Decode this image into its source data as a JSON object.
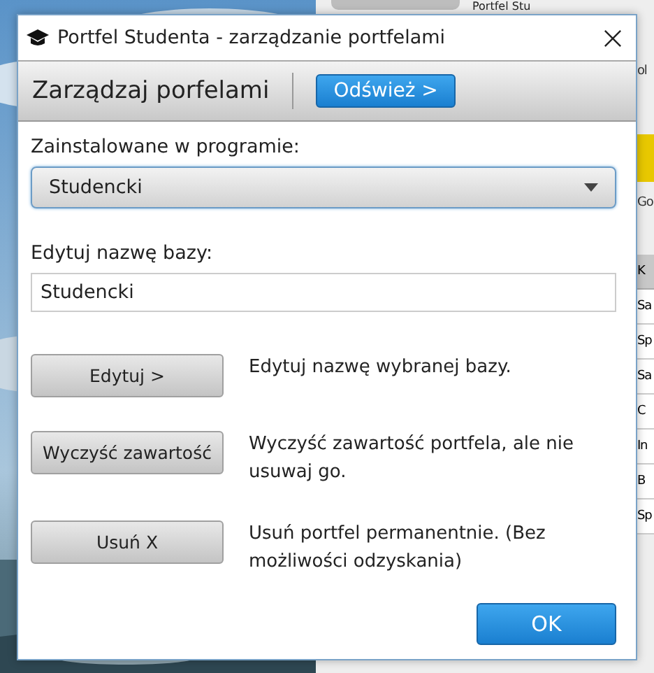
{
  "background_app": {
    "title": "Portfel Stu",
    "side_texts": [
      "ol",
      "Go"
    ],
    "table": {
      "header": "K",
      "rows": [
        "Sa",
        "Sp",
        "Sa",
        "C",
        "In",
        "B",
        "Sp"
      ]
    }
  },
  "dialog": {
    "title": "Portfel Studenta - zarządzanie portfelami",
    "toolbar": {
      "heading": "Zarządzaj porfelami",
      "refresh_button": "Odśwież >"
    },
    "installed": {
      "label": "Zainstalowane w programie:",
      "value": "Studencki"
    },
    "rename": {
      "label": "Edytuj nazwę bazy:",
      "value": "Studencki"
    },
    "actions": [
      {
        "button": "Edytuj >",
        "description": "Edytuj nazwę wybranej bazy."
      },
      {
        "button": "Wyczyść zawartość",
        "description": "Wyczyść zawartość portfela, ale nie usuwaj go."
      },
      {
        "button": "Usuń X",
        "description": "Usuń portfel permanentnie. (Bez możliwości odzyskania)"
      }
    ],
    "ok_button": "OK"
  }
}
